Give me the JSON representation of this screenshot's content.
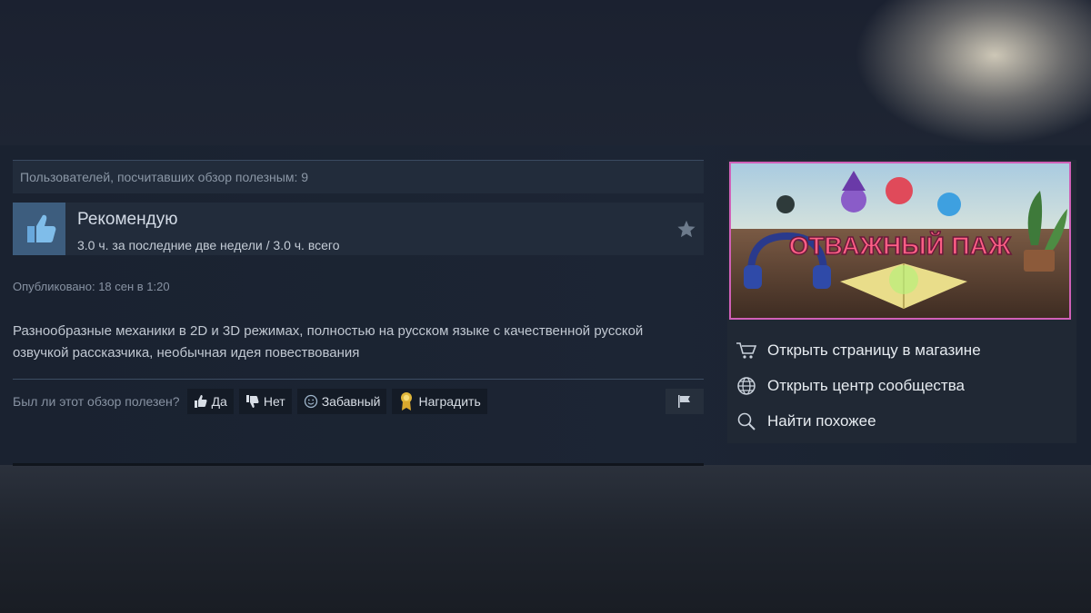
{
  "review": {
    "helpful_count_text": "Пользователей, посчитавших обзор полезным: 9",
    "recommendation": "Рекомендую",
    "hours": "3.0 ч. за последние две недели / 3.0 ч. всего",
    "published": "Опубликовано: 18 сен в 1:20",
    "text": "Разнообразные механики в 2D и 3D режимах, полностью на русском языке с качественной русской озвучкой рассказчика, необычная идея повествования"
  },
  "actions": {
    "question": "Был ли этот обзор полезен?",
    "yes": "Да",
    "no": "Нет",
    "funny": "Забавный",
    "award": "Наградить"
  },
  "game": {
    "logo_text": "ОТВАЖНЫЙ ПАЖ",
    "border_color": "#d060b8"
  },
  "side_links": {
    "store": "Открыть страницу в магазине",
    "community": "Открыть центр сообщества",
    "similar": "Найти похожее"
  },
  "icons": [
    "thumbs-up-icon",
    "star-icon",
    "thumbs-down-icon",
    "smiley-icon",
    "award-icon",
    "flag-icon",
    "cart-icon",
    "globe-icon",
    "search-icon"
  ]
}
